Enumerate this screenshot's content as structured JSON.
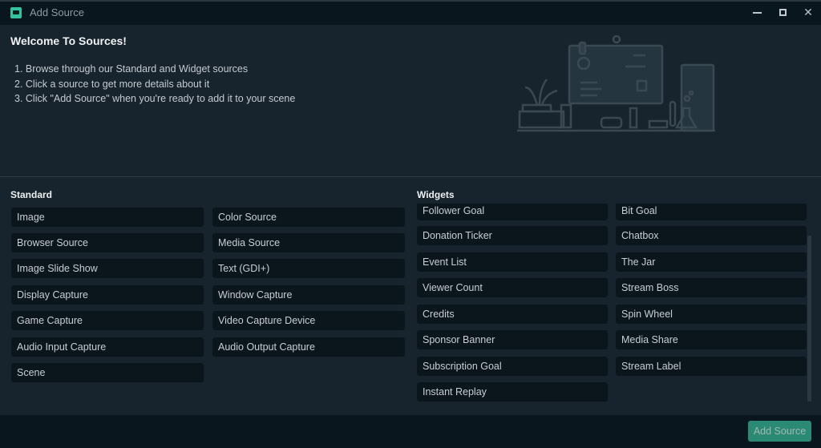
{
  "window": {
    "title": "Add Source",
    "controls": {
      "minimize": "minimize-icon",
      "maximize": "maximize-icon",
      "close": "close-icon"
    }
  },
  "header": {
    "title": "Welcome To Sources!",
    "steps": [
      "1. Browse through our Standard and Widget sources",
      "2. Click a source to get more details about it",
      "3. Click \"Add Source\" when you're ready to add it to your scene"
    ]
  },
  "standard": {
    "label": "Standard",
    "items": [
      "Image",
      "Color Source",
      "Browser Source",
      "Media Source",
      "Image Slide Show",
      "Text (GDI+)",
      "Display Capture",
      "Window Capture",
      "Game Capture",
      "Video Capture Device",
      "Audio Input Capture",
      "Audio Output Capture",
      "Scene"
    ]
  },
  "widgets": {
    "label": "Widgets",
    "items": [
      "Follower Goal",
      "Bit Goal",
      "Donation Ticker",
      "Chatbox",
      "Event List",
      "The Jar",
      "Viewer Count",
      "Stream Boss",
      "Credits",
      "Spin Wheel",
      "Sponsor Banner",
      "Media Share",
      "Subscription Goal",
      "Stream Label",
      "Instant Replay"
    ]
  },
  "footer": {
    "add_source_label": "Add Source"
  },
  "colors": {
    "accent": "#2b8a74",
    "background": "#17242d",
    "item_bg": "#0a151c"
  }
}
